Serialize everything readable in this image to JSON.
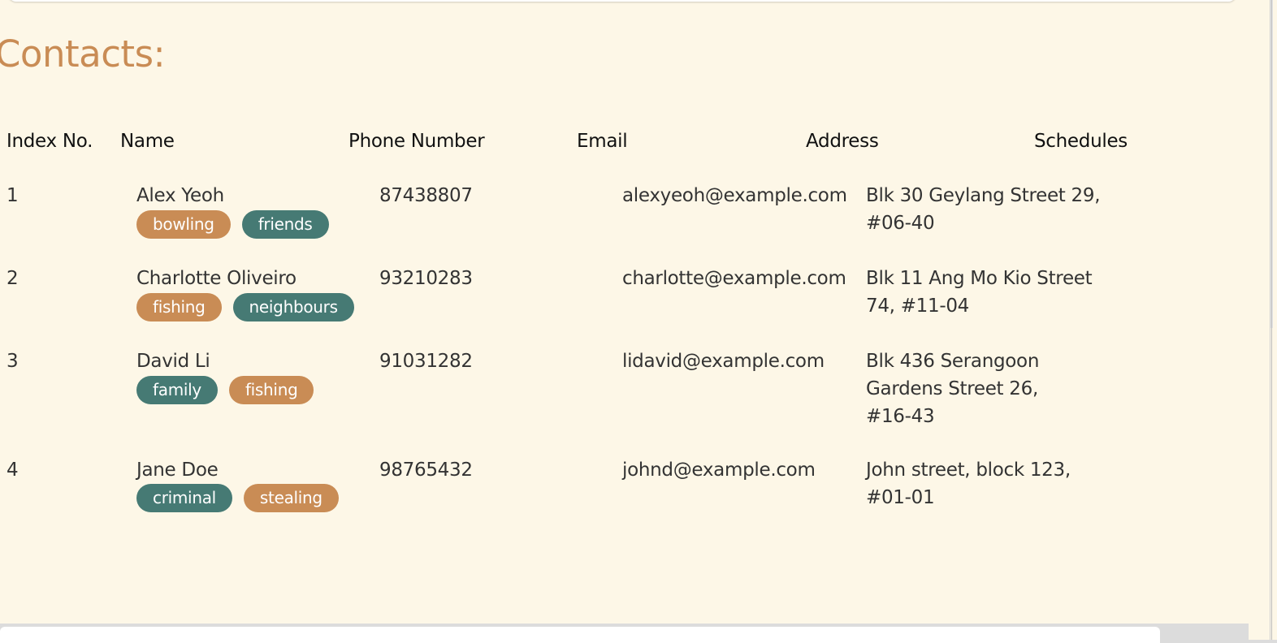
{
  "title": "Contacts:",
  "columns": {
    "index": "Index No.",
    "name": "Name",
    "phone": "Phone Number",
    "email": "Email",
    "address": "Address",
    "schedules": "Schedules"
  },
  "contacts": [
    {
      "index": "1",
      "name": "Alex Yeoh",
      "phone": "87438807",
      "email": "alexyeoh@example.com",
      "address": "Blk 30 Geylang Street 29, #06-40",
      "tags": [
        {
          "label": "bowling",
          "color": "#c98c55"
        },
        {
          "label": "friends",
          "color": "#467a74"
        }
      ]
    },
    {
      "index": "2",
      "name": "Charlotte Oliveiro",
      "phone": "93210283",
      "email": "charlotte@example.com",
      "address": "Blk 11 Ang Mo Kio Street 74, #11-04",
      "tags": [
        {
          "label": "fishing",
          "color": "#c98c55"
        },
        {
          "label": "neighbours",
          "color": "#467a74"
        }
      ]
    },
    {
      "index": "3",
      "name": "David Li",
      "phone": "91031282",
      "email": "lidavid@example.com",
      "address": "Blk 436 Serangoon Gardens Street 26, #16-43",
      "tags": [
        {
          "label": "family",
          "color": "#467a74"
        },
        {
          "label": "fishing",
          "color": "#c98c55"
        }
      ]
    },
    {
      "index": "4",
      "name": "Jane Doe",
      "phone": "98765432",
      "email": "johnd@example.com",
      "address": "John street, block 123, #01-01",
      "tags": [
        {
          "label": "criminal",
          "color": "#467a74"
        },
        {
          "label": "stealing",
          "color": "#c98c55"
        }
      ]
    }
  ],
  "colors": {
    "accent": "#c98c55",
    "tag_teal": "#467a74",
    "background": "#fdf7e7"
  }
}
